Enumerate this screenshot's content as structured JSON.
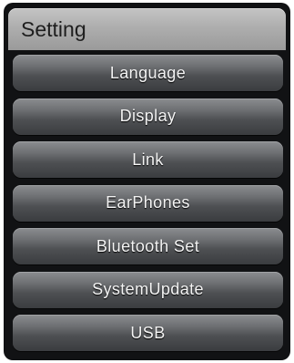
{
  "header": {
    "title": "Setting"
  },
  "menu": {
    "items": [
      {
        "label": "Language"
      },
      {
        "label": "Display"
      },
      {
        "label": "Link"
      },
      {
        "label": "EarPhones"
      },
      {
        "label": "Bluetooth Set"
      },
      {
        "label": "SystemUpdate"
      },
      {
        "label": "USB"
      }
    ]
  }
}
